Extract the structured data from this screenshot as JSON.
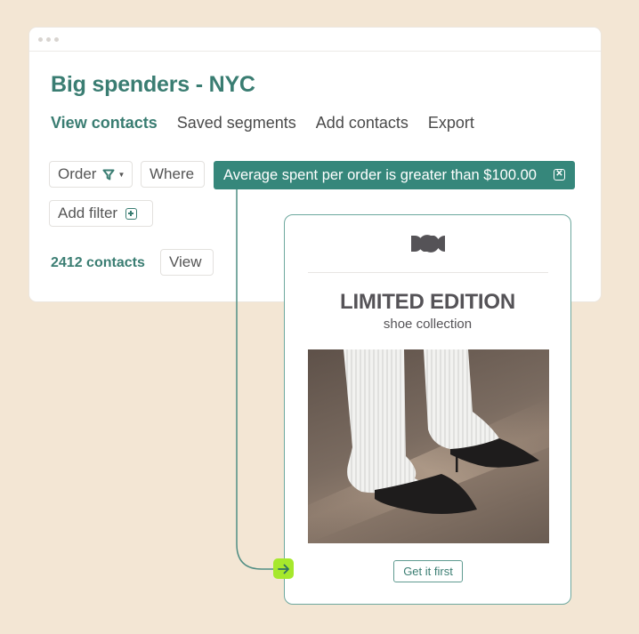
{
  "window": {
    "title": "Big spenders - NYC",
    "tabs": [
      {
        "label": "View contacts",
        "active": true
      },
      {
        "label": "Saved segments",
        "active": false
      },
      {
        "label": "Add contacts",
        "active": false
      },
      {
        "label": "Export",
        "active": false
      }
    ],
    "filters": {
      "order_label": "Order",
      "where_label": "Where",
      "condition": "Average spent per order is greater than $100.00",
      "add_filter_label": "Add filter"
    },
    "contacts": {
      "count_label": "2412 contacts",
      "view_label": "View"
    }
  },
  "email": {
    "logo_icon": "brand-logo-icon",
    "headline": "LIMITED EDITION",
    "subhead": "shoe collection",
    "image": "photo of feet in white ribbed trousers and black pointed kitten-heel mules",
    "cta_label": "Get it first"
  },
  "colors": {
    "accent": "#36877b",
    "background": "#f3e6d4",
    "node": "#a6e82c"
  }
}
